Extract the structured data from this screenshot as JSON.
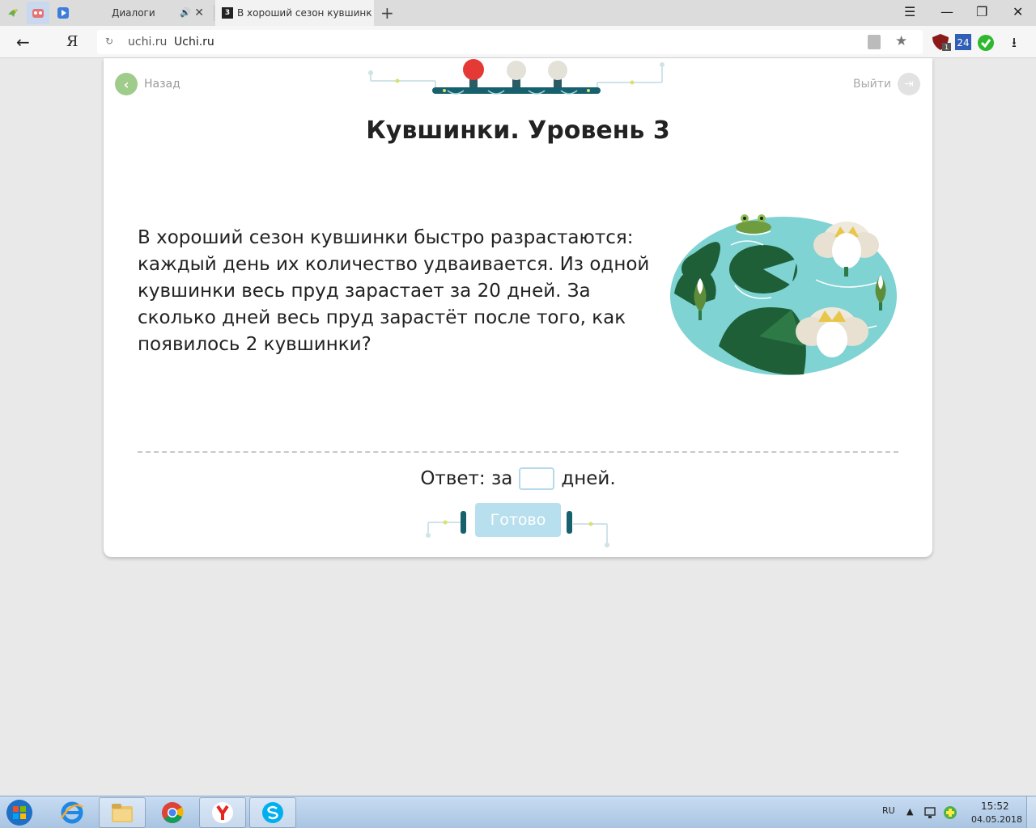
{
  "browser": {
    "tabs": [
      {
        "title": "Диалоги",
        "close": "✕"
      },
      {
        "favicon": "3",
        "title": "В хороший сезон кувшинки",
        "close": "✕"
      }
    ],
    "new_tab": "+",
    "window_controls": {
      "menu": "☰",
      "minimize": "—",
      "restore": "❐",
      "close": "✕"
    },
    "back": "←",
    "yandex_button": "Я",
    "url_domain": "uchi.ru",
    "url_title": "Uchi.ru",
    "star": "★",
    "download": "⭳",
    "extensions": {
      "ublock_badge": "1",
      "counter_badge": "24"
    }
  },
  "page": {
    "back_label": "Назад",
    "exit_label": "Выйти",
    "title": "Кувшинки. Уровень 3",
    "question": "В хороший сезон кувшинки быстро разрастаются: каждый день их количество удваивается. Из одной кувшинки весь пруд зарастает за 20 дней. За сколько дней весь пруд зарастёт после того, как появилось 2 кувшинки?",
    "answer_prefix": "Ответ: за",
    "answer_value": "",
    "answer_suffix": "дней.",
    "done_label": "Готово",
    "progress": {
      "completed": 1,
      "total": 3
    }
  },
  "taskbar": {
    "apps": [
      "internet-explorer",
      "file-explorer",
      "chrome",
      "yandex-browser",
      "skype"
    ],
    "language": "RU",
    "time": "15:52",
    "date": "04.05.2018"
  },
  "colors": {
    "accent_green": "#9fcc8b",
    "pond_water": "#7fd3d3",
    "leaf_dark": "#1f5f37",
    "button_disabled": "#b8dfee",
    "progress_red": "#e53935"
  }
}
